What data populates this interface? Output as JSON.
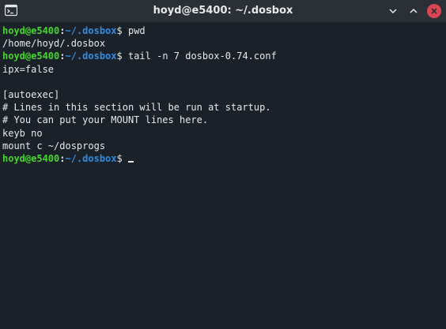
{
  "window": {
    "title": "hoyd@e5400: ~/.dosbox",
    "app_icon": "terminal-icon",
    "controls": [
      "chevron-down-icon",
      "chevron-up-icon",
      "close-icon"
    ]
  },
  "prompt": {
    "user_host": "hoyd@e5400",
    "separator": ":",
    "path": "~/.dosbox",
    "symbol": "$ "
  },
  "lines": [
    {
      "type": "prompt",
      "command": "pwd"
    },
    {
      "type": "output",
      "text": "/home/hoyd/.dosbox"
    },
    {
      "type": "prompt",
      "command": "tail -n 7 dosbox-0.74.conf"
    },
    {
      "type": "output",
      "text": "ipx=false"
    },
    {
      "type": "output",
      "text": ""
    },
    {
      "type": "output",
      "text": "[autoexec]"
    },
    {
      "type": "output",
      "text": "# Lines in this section will be run at startup."
    },
    {
      "type": "output",
      "text": "# You can put your MOUNT lines here."
    },
    {
      "type": "output",
      "text": "keyb no"
    },
    {
      "type": "output",
      "text": "mount c ~/dosprogs"
    },
    {
      "type": "prompt",
      "command": ""
    }
  ],
  "colors": {
    "background": "#1b2128",
    "titlebar": "#2b3036",
    "user_host": "#44d62c",
    "path": "#2f8ce0",
    "text": "#e6e8ea",
    "close_button": "#da4453"
  }
}
